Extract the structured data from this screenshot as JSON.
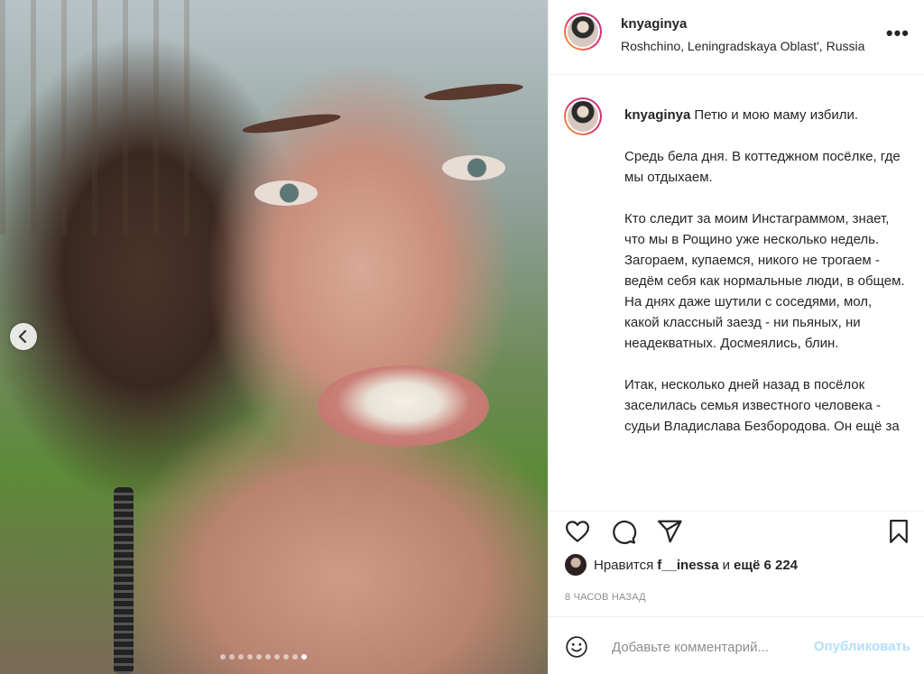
{
  "media": {
    "alt_nav_icon": "chevron-left-icon",
    "carousel_dots": 10,
    "active_dot": 9
  },
  "header": {
    "username": "knyaginya",
    "location": "Roshchino, Leningradskaya Oblast', Russia",
    "more_icon": "•••"
  },
  "caption": {
    "username": "knyaginya",
    "text": "Петю и мою маму избили.\n\nСредь бела дня. В коттеджном посёлке, где мы отдыхаем.\n\nКто следит за моим Инстаграммом, знает, что мы в Рощино уже несколько недель. Загораем, купаемся, никого не трогаем - ведём себя как нормальные люди, в общем. На днях даже шутили с соседями, мол, какой классный заезд - ни пьяных, ни неадекватных. Досмеялись, блин.\n\nИтак, несколько дней назад в посёлок заселилась семья известного человека - судьи Владислава Безбородова. Он ещё за"
  },
  "likes": {
    "prefix": "Нравится",
    "user": "f__inessa",
    "suffix": "и",
    "count": "ещё 6 224"
  },
  "time": "8 ЧАСОВ НАЗАД",
  "comment": {
    "placeholder": "Добавьте комментарий...",
    "publish_label": "Опубликовать"
  },
  "colors": {
    "text": "#262626",
    "muted": "#8e8e8e",
    "publish_disabled": "#b2dffc",
    "border": "#efefef"
  }
}
